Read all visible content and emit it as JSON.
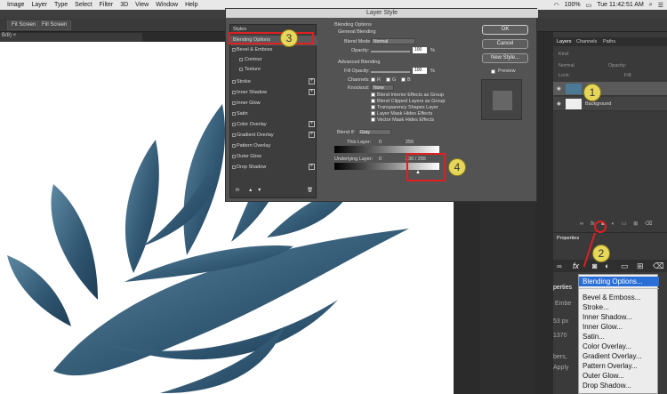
{
  "macbar": {
    "apple": "",
    "items": [
      "Image",
      "Layer",
      "Type",
      "Select",
      "Filter",
      "3D",
      "View",
      "Window",
      "Help"
    ],
    "battery": "100%",
    "clock": "Tue 11:42:51 AM"
  },
  "options": {
    "fit_screen": "Fit Screen",
    "fill_screen": "Fill Screen"
  },
  "doc_tab": "B/8) ×",
  "dialog": {
    "title": "Layer Style",
    "styles_header": "Styles",
    "style_items": [
      "Blending Options",
      "Bevel & Emboss",
      "Contour",
      "Texture",
      "Stroke",
      "Inner Shadow",
      "Inner Glow",
      "Satin",
      "Color Overlay",
      "Gradient Overlay",
      "Pattern Overlay",
      "Outer Glow",
      "Drop Shadow"
    ],
    "blending_title": "Blending Options",
    "general": "General Blending",
    "blend_mode_label": "Blend Mode:",
    "blend_mode": "Normal",
    "opacity_label": "Opacity:",
    "opacity_val": "100",
    "pct": "%",
    "advanced": "Advanced Blending",
    "fill_opacity_label": "Fill Opacity:",
    "fill_val": "100",
    "channels_label": "Channels:",
    "ch_r": "R",
    "ch_g": "G",
    "ch_b": "B",
    "knockout_label": "Knockout:",
    "knockout": "None",
    "checks": [
      "Blend Interior Effects as Group",
      "Blend Clipped Layers as Group",
      "Transparency Shapes Layer",
      "Layer Mask Hides Effects",
      "Vector Mask Hides Effects"
    ],
    "blend_if_label": "Blend If:",
    "blend_if": "Gray",
    "this_layer": "This Layer:",
    "tl_lo": "0",
    "tl_hi": "255",
    "underlying": "Underlying Layer:",
    "ul_lo": "0",
    "ul_hi": "230 / 255",
    "ok": "OK",
    "cancel": "Cancel",
    "new_style": "New Style...",
    "preview": "Preview",
    "fx": "fx"
  },
  "panel": {
    "tabs": [
      "Layers",
      "Channels",
      "Paths"
    ],
    "kind": "Kind",
    "mode": "Normal",
    "opacity": "Opacity:",
    "lock": "Lock:",
    "fill": "Fill:",
    "bg_layer": "Background"
  },
  "properties": {
    "title": "Properties",
    "peek": [
      "perties",
      "Embe",
      "53 px",
      "1370",
      "bers,",
      "Apply"
    ]
  },
  "menu": {
    "items": [
      "Blending Options...",
      "Bevel & Emboss...",
      "Stroke...",
      "Inner Shadow...",
      "Inner Glow...",
      "Satin...",
      "Color Overlay...",
      "Gradient Overlay...",
      "Pattern Overlay...",
      "Outer Glow...",
      "Drop Shadow..."
    ]
  },
  "badges": [
    "1",
    "2",
    "3",
    "4"
  ],
  "colors": {
    "accent": "#2a6fd8",
    "badge": "#e6d75a",
    "marker": "#e02020",
    "leaf": "#3f6a84"
  }
}
